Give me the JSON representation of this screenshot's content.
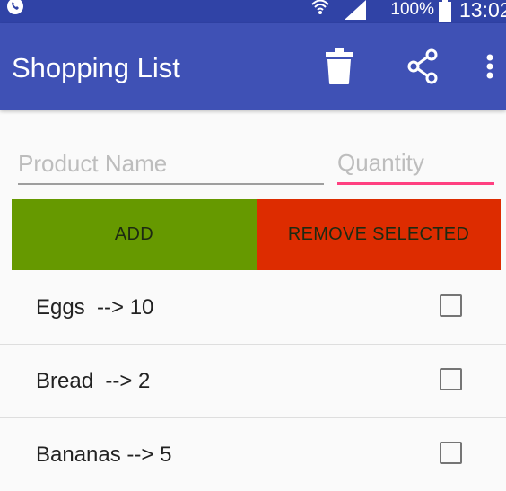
{
  "status_bar": {
    "battery": "100%",
    "time": "13:02",
    "icons": [
      "whatsapp-icon",
      "wifi-icon",
      "signal-icon",
      "battery-icon"
    ]
  },
  "app_bar": {
    "title": "Shopping List",
    "actions": [
      "trash-icon",
      "share-icon",
      "more-vert-icon"
    ]
  },
  "form": {
    "product_placeholder": "Product Name",
    "product_value": "",
    "quantity_placeholder": "Quantity",
    "quantity_value": ""
  },
  "buttons": {
    "add_label": "ADD",
    "remove_label": "REMOVE SELECTED"
  },
  "items": [
    {
      "label": "Eggs  --> 10",
      "checked": false
    },
    {
      "label": "Bread  --> 2",
      "checked": false
    },
    {
      "label": "Bananas --> 5",
      "checked": false
    }
  ],
  "colors": {
    "status_bar": "#3043a6",
    "app_bar": "#3f51b5",
    "add_button": "#669900",
    "remove_button": "#dd2c00",
    "accent": "#ff4081"
  }
}
